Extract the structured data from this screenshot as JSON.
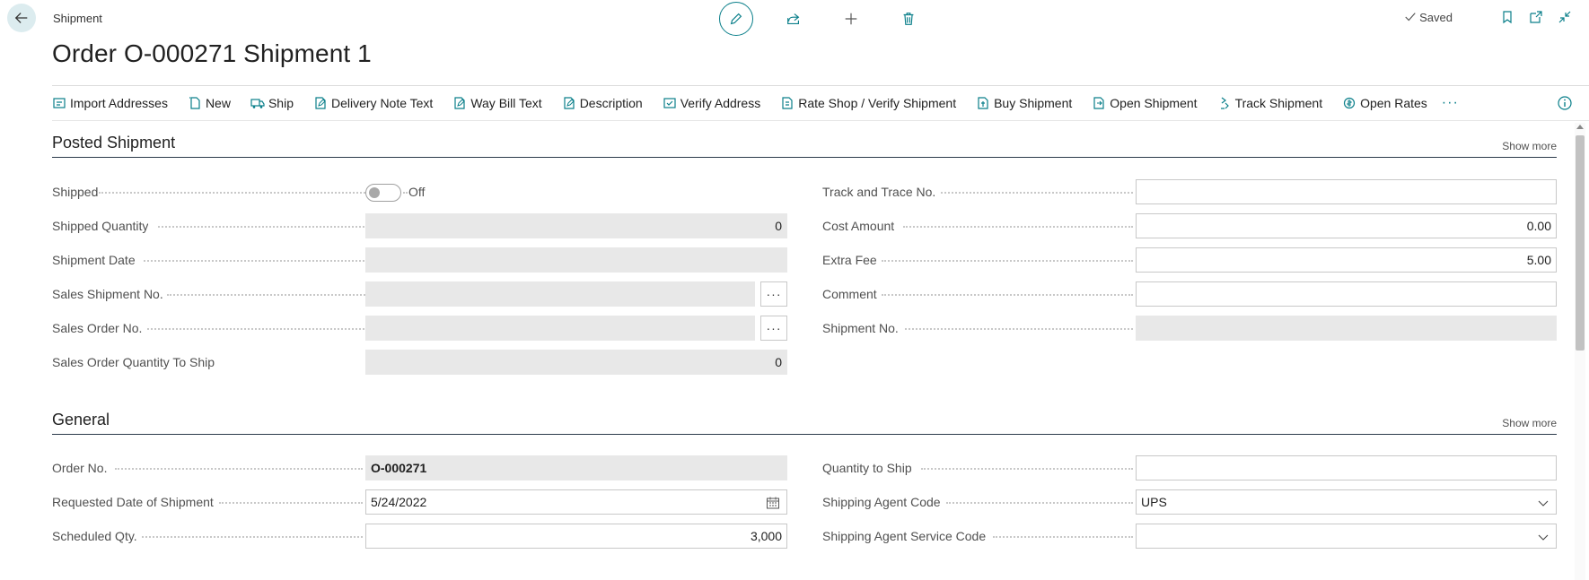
{
  "header": {
    "caption": "Shipment",
    "title": "Order O-000271 Shipment 1",
    "saved_label": "Saved"
  },
  "actions": [
    {
      "label": "Import Addresses",
      "icon": "import-addresses-icon"
    },
    {
      "label": "New",
      "icon": "new-document-icon"
    },
    {
      "label": "Ship",
      "icon": "ship-truck-icon"
    },
    {
      "label": "Delivery Note Text",
      "icon": "edit-document-icon"
    },
    {
      "label": "Way Bill Text",
      "icon": "edit-document-icon"
    },
    {
      "label": "Description",
      "icon": "edit-document-icon"
    },
    {
      "label": "Verify Address",
      "icon": "verify-address-icon"
    },
    {
      "label": "Rate Shop / Verify Shipment",
      "icon": "rate-shop-icon"
    },
    {
      "label": "Buy Shipment",
      "icon": "buy-shipment-icon"
    },
    {
      "label": "Open Shipment",
      "icon": "open-shipment-icon"
    },
    {
      "label": "Track Shipment",
      "icon": "track-shipment-icon"
    },
    {
      "label": "Open Rates",
      "icon": "open-rates-icon"
    }
  ],
  "more_label": "···",
  "colors": {
    "accent": "#0a7f8a",
    "readonly_bg": "#e8e8e8",
    "section_rule": "#2b3a4a"
  },
  "posted": {
    "title": "Posted Shipment",
    "show_more": "Show more",
    "shipped": {
      "label": "Shipped",
      "state": "Off"
    },
    "shipped_quantity": {
      "label": "Shipped Quantity",
      "value": "0"
    },
    "shipment_date": {
      "label": "Shipment Date",
      "value": ""
    },
    "sales_shipment_no": {
      "label": "Sales Shipment No.",
      "value": ""
    },
    "sales_order_no": {
      "label": "Sales Order No.",
      "value": ""
    },
    "sales_order_qty_to_ship": {
      "label": "Sales Order Quantity To Ship",
      "value": "0"
    },
    "track_and_trace_no": {
      "label": "Track and Trace No.",
      "value": ""
    },
    "cost_amount": {
      "label": "Cost Amount",
      "value": "0.00"
    },
    "extra_fee": {
      "label": "Extra Fee",
      "value": "5.00"
    },
    "comment": {
      "label": "Comment",
      "value": ""
    },
    "shipment_no": {
      "label": "Shipment No.",
      "value": ""
    }
  },
  "general": {
    "title": "General",
    "show_more": "Show more",
    "order_no": {
      "label": "Order No.",
      "value": "O-000271"
    },
    "requested_date": {
      "label": "Requested Date of Shipment",
      "value": "5/24/2022"
    },
    "scheduled_qty": {
      "label": "Scheduled Qty.",
      "value": "3,000"
    },
    "quantity_to_ship": {
      "label": "Quantity to Ship",
      "value": ""
    },
    "shipping_agent_code": {
      "label": "Shipping Agent Code",
      "value": "UPS"
    },
    "shipping_agent_service_code": {
      "label": "Shipping Agent Service Code",
      "value": ""
    }
  }
}
